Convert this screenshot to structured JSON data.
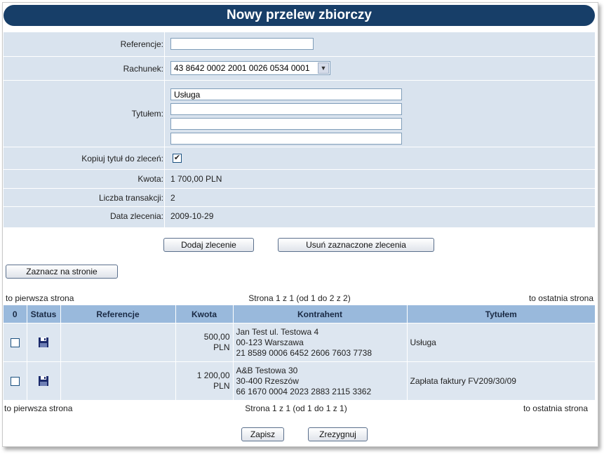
{
  "title": "Nowy przelew zbiorczy",
  "form": {
    "referencje_label": "Referencje:",
    "referencje_value": "",
    "rachunek_label": "Rachunek:",
    "rachunek_value": "43 8642 0002 2001 0026 0534 0001",
    "tytulem_label": "Tytułem:",
    "tytulem_lines": [
      "Usługa",
      "",
      "",
      ""
    ],
    "kopiuj_label": "Kopiuj tytuł do zleceń:",
    "kopiuj_checked": true,
    "kwota_label": "Kwota:",
    "kwota_value": "1 700,00 PLN",
    "liczba_label": "Liczba transakcji:",
    "liczba_value": "2",
    "data_label": "Data zlecenia:",
    "data_value": "2009-10-29"
  },
  "buttons": {
    "add_order": "Dodaj zlecenie",
    "delete_selected": "Usuń zaznaczone zlecenia",
    "select_on_page": "Zaznacz na stronie",
    "save": "Zapisz",
    "cancel": "Zrezygnuj"
  },
  "pager_top": {
    "first": "to pierwsza strona",
    "info": "Strona 1 z 1 (od 1 do 2 z 2)",
    "last": "to ostatnia strona"
  },
  "pager_bottom": {
    "first": "to pierwsza strona",
    "info": "Strona 1 z 1 (od 1 do 1 z 1)",
    "last": "to ostatnia strona"
  },
  "table": {
    "headers": [
      "0",
      "Status",
      "Referencje",
      "Kwota",
      "Kontrahent",
      "Tytułem"
    ],
    "rows": [
      {
        "checked": false,
        "status_icon": "floppy-disk-icon",
        "referencje": "",
        "kwota_amount": "500,00",
        "kwota_currency": "PLN",
        "kontrahent_lines": [
          "Jan Test  ul. Testowa 4",
          "00-123 Warszawa",
          "21 8589 0006 6452 2606 7603 7738"
        ],
        "tytulem": "Usługa"
      },
      {
        "checked": false,
        "status_icon": "floppy-disk-icon",
        "referencje": "",
        "kwota_amount": "1 200,00",
        "kwota_currency": "PLN",
        "kontrahent_lines": [
          "A&B Testowa 30",
          "30-400 Rzeszów",
          "66 1670 0004 2023 2883 2115 3362"
        ],
        "tytulem": "Zapłata faktury FV209/30/09"
      }
    ]
  },
  "colors": {
    "title_bar": "#173e68",
    "form_bg": "#d9e3ee",
    "table_header": "#99b9dc",
    "table_row": "#dde6f0"
  }
}
